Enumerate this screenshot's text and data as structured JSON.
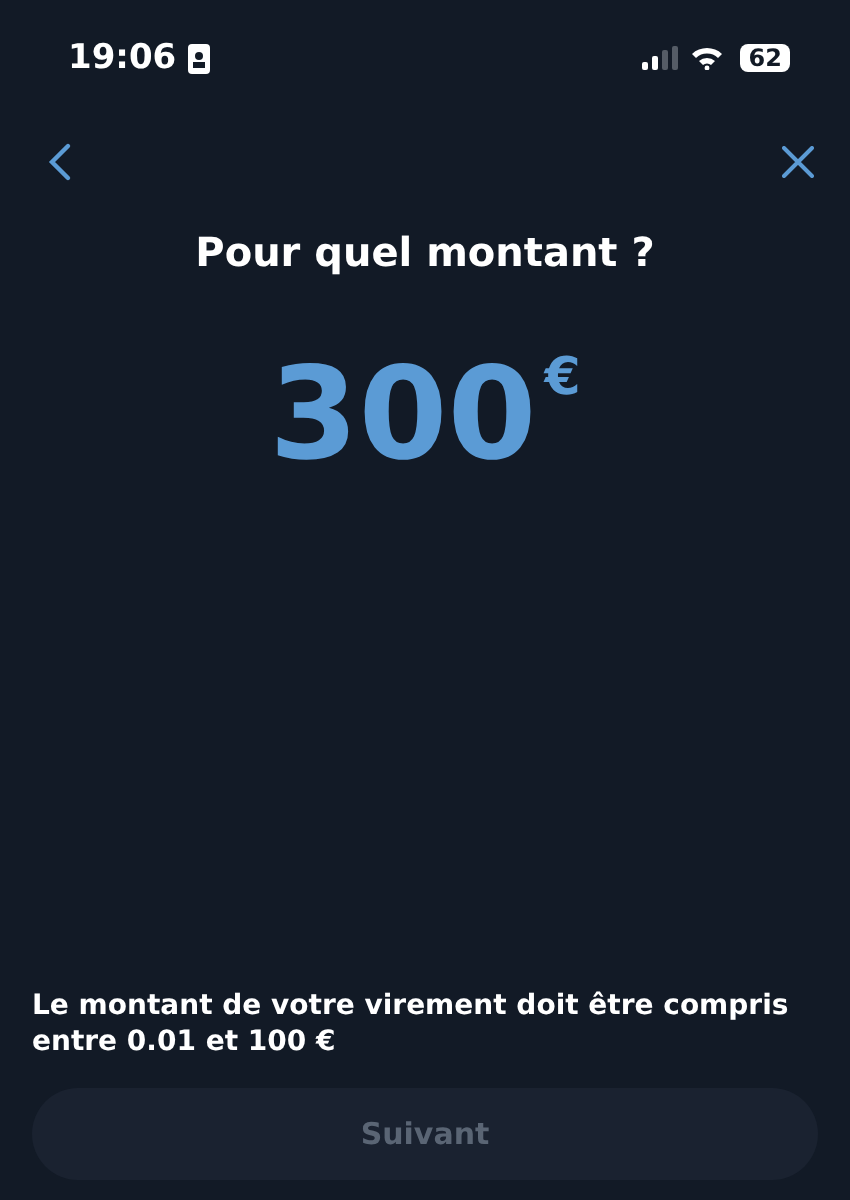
{
  "status_bar": {
    "time": "19:06",
    "battery": "62"
  },
  "title": "Pour quel montant ?",
  "amount": {
    "value": "300",
    "currency": "€"
  },
  "message": "Le montant de votre virement doit être compris entre 0.01 et 100 €",
  "next_button": {
    "label": "Suivant",
    "disabled": true
  }
}
